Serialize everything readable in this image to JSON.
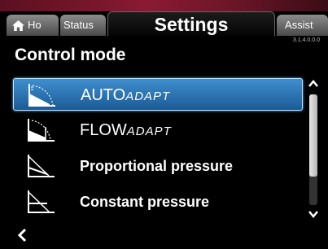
{
  "tabs": {
    "home": "Ho",
    "status": "Status",
    "settings": "Settings",
    "assist": "Assist"
  },
  "version": "3.1.4.0.0.0",
  "page_title": "Control mode",
  "items": [
    {
      "main": "AUTO",
      "suffix": "ADAPT",
      "selected": true,
      "icon": "auto-adapt-curve-icon"
    },
    {
      "main": "FLOW",
      "suffix": "ADAPT",
      "selected": false,
      "icon": "flow-adapt-curve-icon"
    },
    {
      "main": "Proportional pressure",
      "suffix": "",
      "selected": false,
      "icon": "proportional-pressure-curve-icon"
    },
    {
      "main": "Constant pressure",
      "suffix": "",
      "selected": false,
      "icon": "constant-pressure-curve-icon"
    }
  ],
  "scroll": {
    "thumb_fraction": 0.74
  },
  "colors": {
    "selection": "#2f7fc0",
    "background": "#000000"
  }
}
